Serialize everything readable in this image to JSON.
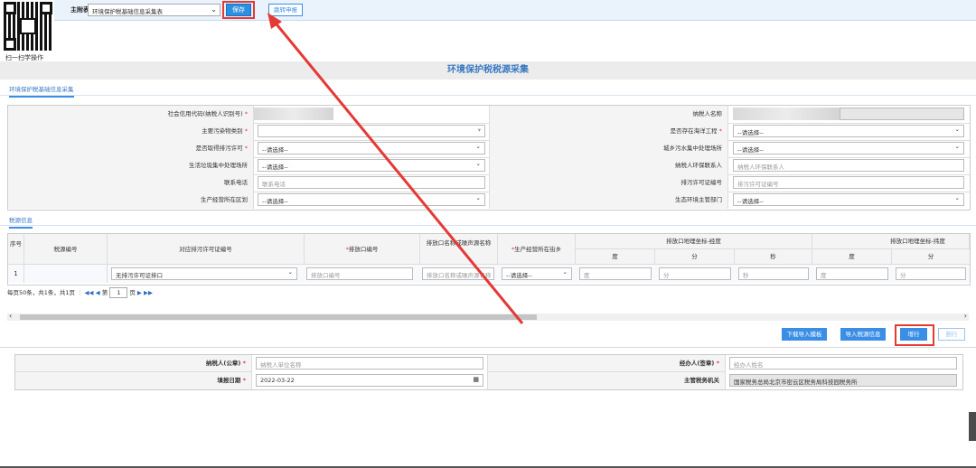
{
  "qr": {
    "label": "扫一扫学操作"
  },
  "topbar": {
    "main_label": "主附表树:",
    "form_select": "环境保护税基础信息采集表",
    "save_label": "保存",
    "jump_label": "跳转申报"
  },
  "page_title": "环境保护税税源采集",
  "tabs": {
    "basic": "环境保护税基础信息采集",
    "source": "税源信息"
  },
  "form": {
    "rows": [
      {
        "l_label": "社会信用代码(纳税人识别号)",
        "l_star": "*",
        "r_label": "纳税人名称",
        "r_star": ""
      },
      {
        "l_label": "主要污染物类别",
        "l_star": "*",
        "r_label": "是否存在海洋工程",
        "r_star": "*",
        "r_value": "--请选择--"
      },
      {
        "l_label": "是否取得排污许可",
        "l_star": "*",
        "l_value": "--请选择--",
        "r_label": "城乡污水集中处理场所",
        "r_star": "",
        "r_value": "--请选择--"
      },
      {
        "l_label": "生活垃圾集中处理场所",
        "l_star": "",
        "l_value": "--请选择--",
        "r_label": "纳税人环保联系人",
        "r_star": "",
        "r_placeholder": "纳税人环保联系人"
      },
      {
        "l_label": "联系电话",
        "l_star": "",
        "l_placeholder": "联系电话",
        "r_label": "排污许可证编号",
        "r_star": "",
        "r_placeholder": "排污许可证编号"
      },
      {
        "l_label": "生产经营所在区划",
        "l_star": "",
        "l_value": "--请选择--",
        "r_label": "生态环境主管部门",
        "r_star": "",
        "r_value": "--请选择--"
      }
    ]
  },
  "grid": {
    "headers": {
      "seq": "序号",
      "tax_no": "税源编号",
      "permit": "对应排污许可证编号",
      "outlet": "排放口编号",
      "outlet_star": "*",
      "outlet_name": "排放口名称或噪声源名称",
      "street": "生产经营所在街乡",
      "street_star": "*",
      "lon_group": "排放口地理坐标-经度",
      "lat_group": "排放口地理坐标-纬度",
      "deg": "度",
      "min": "分",
      "sec": "秒",
      "deg2": "度",
      "min2": "分"
    },
    "row": {
      "seq": "1",
      "permit_value": "无排污许可证排口",
      "outlet_ph": "排放口编号",
      "outlet_name_ph": "排放口名称或噪声源名称",
      "street_value": "--请选择--",
      "deg_ph": "度",
      "min_ph": "分",
      "sec_ph": "秒",
      "deg2_ph": "度",
      "min2_ph": "分"
    }
  },
  "pager": {
    "summary": "每页50条，共1条，共1页",
    "first": "◀◀",
    "prev": "◀",
    "page_prefix": "第",
    "page_value": "1",
    "page_suffix": "页",
    "next": "▶",
    "last": "▶▶"
  },
  "actions": {
    "download_template": "下载导入模板",
    "import_tax_info": "导入税源信息",
    "add_row": "增行",
    "delete_row": "删行"
  },
  "bottom_form": {
    "taxpayer_label": "纳税人(公章)",
    "taxpayer_star": "*",
    "taxpayer_ph": "纳税人单位名称",
    "agent_label": "经办人(签章)",
    "agent_star": "*",
    "agent_ph": "经办人姓名",
    "fill_date_label": "填报日期",
    "fill_date_star": "*",
    "fill_date_value": "2022-03-22",
    "authority_label": "主管税务机关",
    "authority_value": "国家税务总局北京市密云区税务局科技园税务所"
  },
  "colors": {
    "accent": "#3a8ee6",
    "highlight": "#e53935"
  }
}
